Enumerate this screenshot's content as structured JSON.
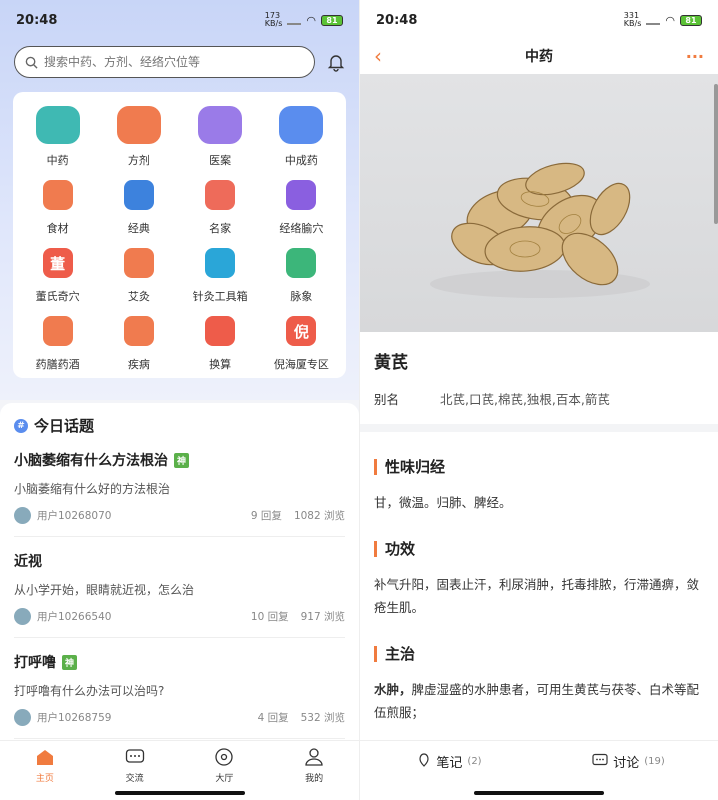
{
  "left": {
    "status": {
      "time": "20:48",
      "net": "173\nKB/s",
      "battery": "81"
    },
    "search": {
      "placeholder": "搜索中药、方剂、经络穴位等"
    },
    "grid": [
      {
        "label": "中药",
        "icon": "gift-icon",
        "color": "#3fb9b3"
      },
      {
        "label": "方剂",
        "icon": "mortar-icon",
        "color": "#f07b4f"
      },
      {
        "label": "医案",
        "icon": "notebook-icon",
        "color": "#9a7be8"
      },
      {
        "label": "中成药",
        "icon": "medicine-bottle-icon",
        "color": "#5a8dee"
      },
      {
        "label": "食材",
        "icon": "food-cover-icon",
        "color": "#f07b4f"
      },
      {
        "label": "经典",
        "icon": "book-icon",
        "color": "#3d82dd"
      },
      {
        "label": "名家",
        "icon": "person-icon",
        "color": "#ee6b5a"
      },
      {
        "label": "经络腧穴",
        "icon": "acupoint-icon",
        "color": "#8a5fe0"
      },
      {
        "label": "董氏奇穴",
        "icon": "dong-icon",
        "glyph": "董",
        "color": "#ee5c4a"
      },
      {
        "label": "艾灸",
        "icon": "fire-icon",
        "color": "#f07b4f"
      },
      {
        "label": "针灸工具箱",
        "icon": "cube-icon",
        "color": "#2aa6d8"
      },
      {
        "label": "脉象",
        "icon": "hand-icon",
        "color": "#3cb67a"
      },
      {
        "label": "药膳药酒",
        "icon": "bowl-icon",
        "color": "#f07b4f"
      },
      {
        "label": "疾病",
        "icon": "open-book-icon",
        "color": "#f07b4f"
      },
      {
        "label": "换算",
        "icon": "calculator-icon",
        "color": "#ee5c4a"
      },
      {
        "label": "倪海厦专区",
        "icon": "ni-notebook-icon",
        "glyph": "倪",
        "color": "#ee5c4a"
      }
    ],
    "topics_title": "今日话题",
    "topics": [
      {
        "title": "小脑萎缩有什么方法根治",
        "badge": "神",
        "desc": "小脑萎缩有什么好的方法根治",
        "user": "用户10268070",
        "replies": "9 回复",
        "views": "1082 浏览"
      },
      {
        "title": "近视",
        "badge": "",
        "desc": "从小学开始，眼睛就近视，怎么治",
        "user": "用户10266540",
        "replies": "10 回复",
        "views": "917 浏览"
      },
      {
        "title": "打呼噜",
        "badge": "神",
        "desc": "打呼噜有什么办法可以治吗?",
        "user": "用户10268759",
        "replies": "4 回复",
        "views": "532 浏览"
      }
    ],
    "nav": [
      {
        "label": "主页",
        "icon": "home-icon",
        "active": true
      },
      {
        "label": "交流",
        "icon": "chat-icon",
        "active": false
      },
      {
        "label": "大厅",
        "icon": "hall-icon",
        "active": false
      },
      {
        "label": "我的",
        "icon": "profile-icon",
        "active": false
      }
    ]
  },
  "right": {
    "status": {
      "time": "20:48",
      "net": "331\nKB/s",
      "battery": "81"
    },
    "header": {
      "title": "中药",
      "back": "‹",
      "more": "···"
    },
    "herb": {
      "name": "黄芪",
      "alias_label": "别名",
      "alias_value": "北芪,口芪,棉芪,独根,百本,箭芪"
    },
    "sections": [
      {
        "title": "性味归经",
        "body": "甘，微温。归肺、脾经。"
      },
      {
        "title": "功效",
        "body": "补气升阳，固表止汗，利尿消肿，托毒排脓，行滞通痹，敛疮生肌。"
      },
      {
        "title": "主治",
        "body_bold": "水肿，",
        "body": "脾虚湿盛的水肿患者，可用生黄芪与茯苓、白术等配伍煎服；"
      }
    ],
    "actions": [
      {
        "label": "笔记",
        "count": "(2)",
        "icon": "note-icon"
      },
      {
        "label": "讨论",
        "count": "(19)",
        "icon": "discuss-icon"
      }
    ]
  }
}
